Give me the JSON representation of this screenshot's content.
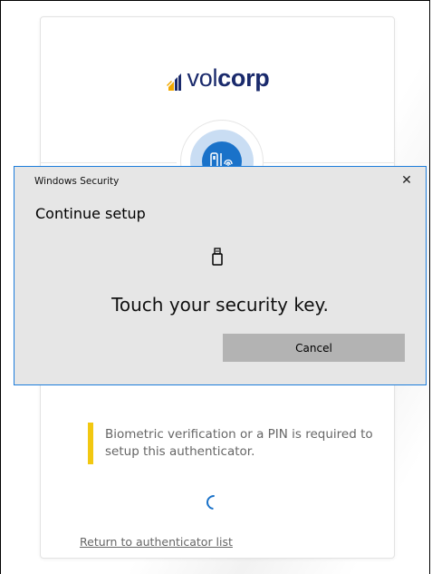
{
  "brand": {
    "name_part1": "vol",
    "name_part2": "corp"
  },
  "dialog": {
    "window_title": "Windows Security",
    "close_glyph": "✕",
    "heading": "Continue setup",
    "message": "Touch your security key.",
    "cancel_label": "Cancel",
    "accent_color": "#1d7ddb"
  },
  "setup": {
    "notice": "Biometric verification or a PIN is required to setup this authenticator.",
    "notice_color": "#f2c811",
    "back_link": "Return to authenticator list",
    "factor_icon": "security-key-fingerprint-icon"
  }
}
